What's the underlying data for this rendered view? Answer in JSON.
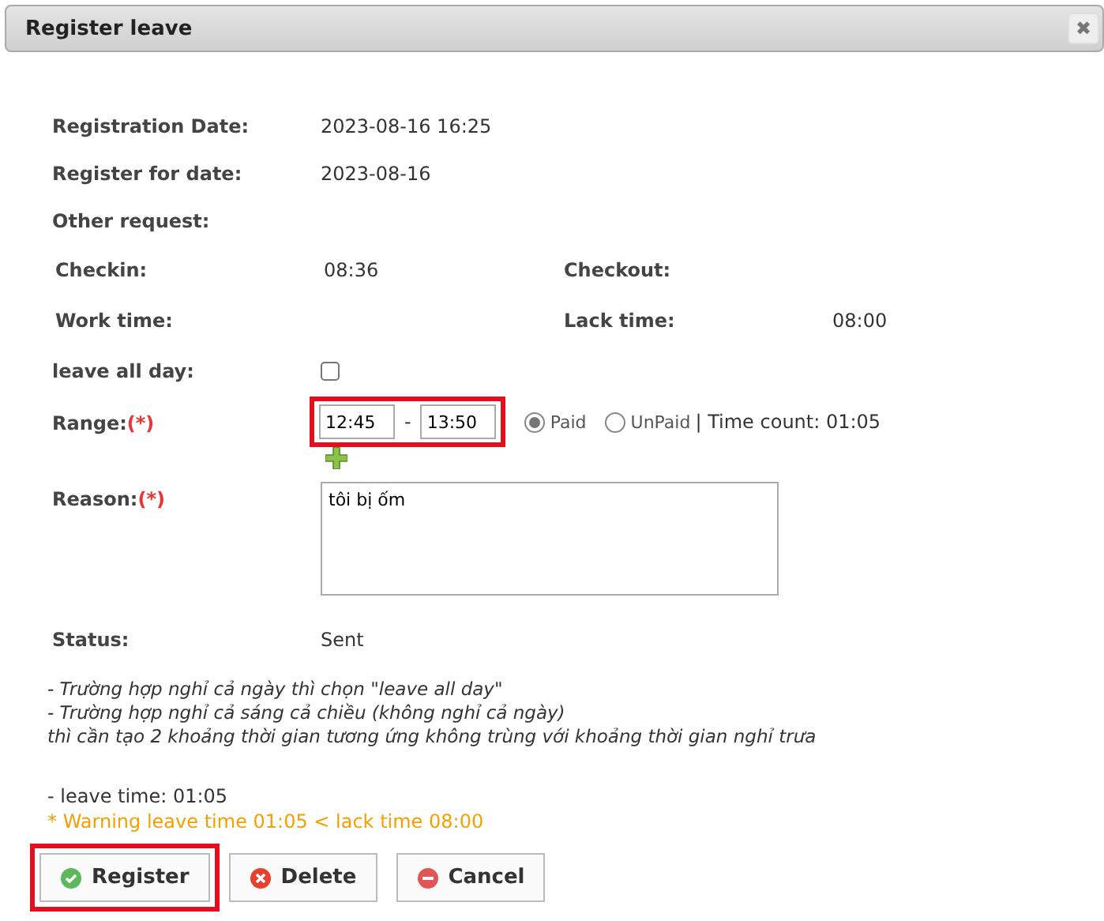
{
  "window": {
    "title": "Register leave",
    "close": "✖"
  },
  "fields": [
    {
      "label": "Registration Date:",
      "value": "2023-08-16 16:25"
    },
    {
      "label": "Register for date:",
      "value": "2023-08-16"
    },
    {
      "label": "Other request:"
    }
  ],
  "times": [
    {
      "label": "Checkin:",
      "value": "08:36",
      "label2": "Checkout:"
    },
    {
      "label": "Work time:",
      "label2": "Lack time:",
      "value2": "08:00"
    }
  ],
  "leave_all_day": {
    "label": "leave all day:",
    "checked": false
  },
  "range": {
    "label": "Range:",
    "required": "(*)",
    "highlighted": true,
    "from": "12:45",
    "separator": "-",
    "to": "13:50",
    "options": [
      {
        "label": "Paid",
        "selected": true
      },
      {
        "label": "UnPaid",
        "selected": false
      }
    ],
    "time_count": "| Time count: 01:05"
  },
  "reason": {
    "label": "Reason:",
    "required": "(*)",
    "value": "tôi bị ốm"
  },
  "status": {
    "label": "Status:",
    "value": "Sent"
  },
  "notes": [
    "- Trường hợp nghỉ cả ngày thì chọn \"leave all day\"",
    "- Trường hợp nghỉ cả sáng cả chiều (không nghỉ cả ngày)",
    "thì cần tạo 2 khoảng thời gian tương ứng không trùng với khoảng thời gian nghỉ trưa"
  ],
  "leave_time": "- leave time: 01:05",
  "warning": "* Warning leave time 01:05 < lack time 08:00",
  "buttons": [
    {
      "label": "Register",
      "kind": "ok",
      "highlighted": true
    },
    {
      "label": "Delete",
      "kind": "delete",
      "highlighted": false
    },
    {
      "label": "Cancel",
      "kind": "cancel",
      "highlighted": false
    }
  ]
}
